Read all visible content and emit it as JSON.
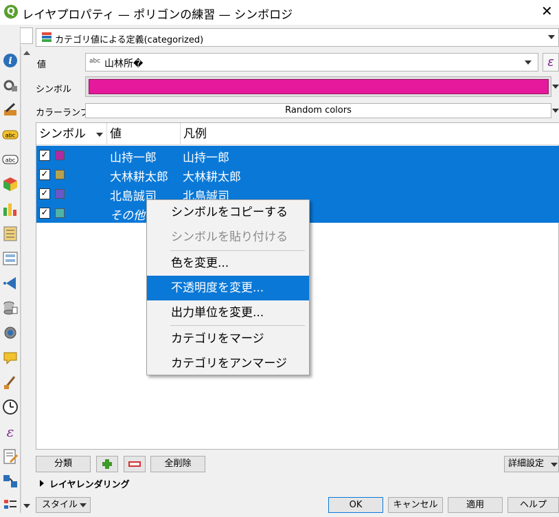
{
  "window": {
    "title": "レイヤプロパティ — ポリゴンの練習 — シンボロジ",
    "app_icon": "Q"
  },
  "renderer": {
    "selected": "カテゴリ値による定義(categorized)"
  },
  "form": {
    "value_label": "値",
    "value_type": "abc",
    "value": "山林所�",
    "expression_symbol": "ε",
    "symbol_label": "シンボル",
    "symbol_color": "#e5199b",
    "color_ramp_label": "カラーランプ",
    "color_ramp": "Random colors"
  },
  "table": {
    "columns": [
      "シンボル",
      "値",
      "凡例"
    ],
    "rows": [
      {
        "checked": true,
        "color": "#b02aa0",
        "value": "山持一郎",
        "legend": "山持一郎",
        "italic": false
      },
      {
        "checked": true,
        "color": "#b6a24e",
        "value": "大林耕太郎",
        "legend": "大林耕太郎",
        "italic": false
      },
      {
        "checked": true,
        "color": "#6a58c8",
        "value": "北島誠司",
        "legend": "北島誠司",
        "italic": false
      },
      {
        "checked": true,
        "color": "#4fb3a6",
        "value": "その他",
        "legend": "",
        "italic": true
      }
    ],
    "checkmark": "✓"
  },
  "context_menu": {
    "items": [
      {
        "label": "シンボルをコピーする",
        "state": "normal"
      },
      {
        "label": "シンボルを貼り付ける",
        "state": "disabled"
      },
      {
        "label": "色を変更...",
        "state": "normal"
      },
      {
        "label": "不透明度を変更...",
        "state": "highlighted"
      },
      {
        "label": "出力単位を変更...",
        "state": "normal"
      },
      {
        "label": "カテゴリをマージ",
        "state": "normal"
      },
      {
        "label": "カテゴリをアンマージ",
        "state": "normal"
      }
    ]
  },
  "buttons": {
    "classify": "分類",
    "delete_all": "全削除",
    "advanced": "詳細設定",
    "style": "スタイル",
    "ok": "OK",
    "cancel": "キャンセル",
    "apply": "適用",
    "help": "ヘルプ"
  },
  "layer_rendering": "レイヤレンダリング",
  "colors": {
    "accent": "#0a78d7",
    "add_green": "#3e9a2a",
    "remove_red": "#d43030"
  },
  "sidebar_icons": [
    "information-icon",
    "source-icon",
    "symbology-icon",
    "labels-icon",
    "masks-icon",
    "3d-view-icon",
    "diagrams-icon",
    "fields-icon",
    "attributes-form-icon",
    "joins-icon",
    "auxiliary-storage-icon",
    "actions-icon",
    "display-icon",
    "rendering-icon",
    "temporal-icon",
    "variables-icon",
    "metadata-icon",
    "dependencies-icon",
    "legend-icon"
  ]
}
